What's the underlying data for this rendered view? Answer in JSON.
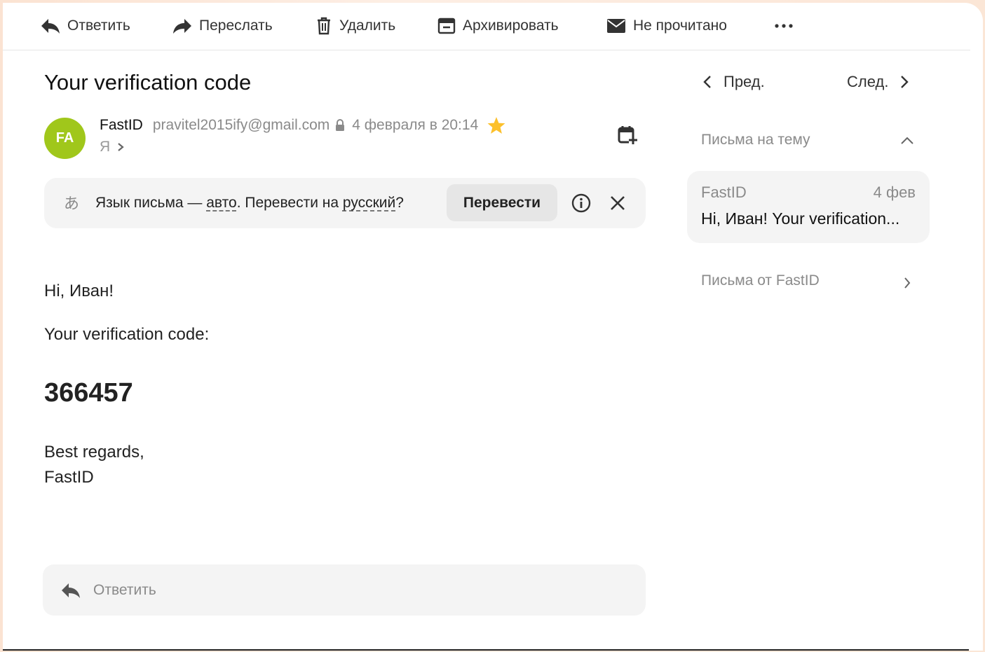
{
  "toolbar": {
    "reply": "Ответить",
    "forward": "Переслать",
    "delete": "Удалить",
    "archive": "Архивировать",
    "unread": "Не прочитано"
  },
  "message": {
    "subject": "Your verification code",
    "avatar_initials": "FA",
    "avatar_color": "#a0c71b",
    "sender_name": "FastID",
    "sender_email": "pravitel2015ify@gmail.com",
    "date": "4 февраля в 20:14",
    "recipient": "Я",
    "starred": true
  },
  "translate": {
    "prefix": "Язык письма — ",
    "lang": "авто",
    "middle": ". Перевести на ",
    "target": "русский",
    "suffix": "?",
    "button": "Перевести"
  },
  "body": {
    "greeting": "Hi, Иван!",
    "intro": "Your verification code:",
    "code": "366457",
    "closing": "Best regards,",
    "signature": "FastID"
  },
  "reply_box": {
    "label": "Ответить"
  },
  "sidebar": {
    "prev": "Пред.",
    "next": "След.",
    "thread_header": "Письма на тему",
    "thread_item": {
      "sender": "FastID",
      "date": "4 фев",
      "subject": "Hi, Иван! Your verification..."
    },
    "from_sender": "Письма от FastID"
  }
}
